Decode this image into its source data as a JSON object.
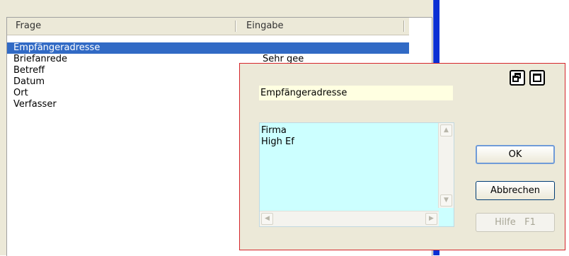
{
  "list": {
    "columns": {
      "frage": "Frage",
      "eingabe": "Eingabe"
    },
    "rows": [
      {
        "frage": "Empfängeradresse",
        "eingabe": ""
      },
      {
        "frage": "Briefanrede",
        "eingabe": "Sehr gee"
      },
      {
        "frage": "Betreff",
        "eingabe": ""
      },
      {
        "frage": "Datum",
        "eingabe": ""
      },
      {
        "frage": "Ort",
        "eingabe": ""
      },
      {
        "frage": "Verfasser",
        "eingabe": ""
      }
    ]
  },
  "dialog": {
    "question_label": "Empfängeradresse",
    "answer_text": "Firma\nHigh Ef",
    "ok_label": "OK",
    "cancel_label": "Abbrechen",
    "help_label": "Hilfe   F1"
  },
  "icons": {
    "restore": "restore-window-icon",
    "maximize": "maximize-window-icon"
  },
  "colors": {
    "selection": "#316ac5",
    "answer_bg": "#ccffff",
    "question_bg": "#ffffe1",
    "dialog_border": "#d6242a",
    "window_border": "#0a2fd4"
  }
}
